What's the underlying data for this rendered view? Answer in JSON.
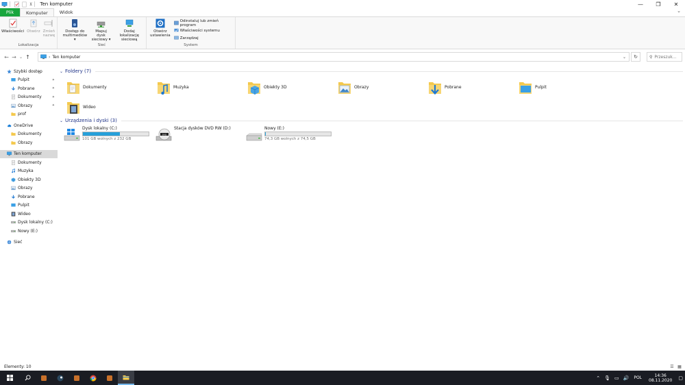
{
  "window": {
    "title": "Ten komputer",
    "controls": {
      "minimize": "—",
      "maximize": "❐",
      "close": "✕"
    }
  },
  "tabs": {
    "file": "Plik",
    "computer": "Komputer",
    "view": "Widok",
    "expand": "⌄"
  },
  "ribbon": {
    "groups": {
      "location": "Lokalizacja",
      "network": "Sieć",
      "system": "System"
    },
    "buttons": {
      "properties": "Właściwości",
      "open": "Otwórz",
      "rename_1": "Zmień",
      "rename_2": "nazwę",
      "media_1": "Dostęp do",
      "media_2": "multimediów ▾",
      "map_1": "Mapuj dysk",
      "map_2": "sieciowy ▾",
      "addloc_1": "Dodaj lokalizację",
      "addloc_2": "sieciową",
      "settings_1": "Otwórz",
      "settings_2": "ustawienia"
    },
    "system_items": {
      "uninstall": "Odinstaluj lub zmień program",
      "sysprops": "Właściwości systemu",
      "manage": "Zarządzaj"
    }
  },
  "nav": {
    "back": "←",
    "forward": "→",
    "recent": "⌄",
    "up": "↑",
    "address": "Ten komputer",
    "address_dropdown": "⌄",
    "refresh": "↻",
    "search_placeholder": "Przeszuk..."
  },
  "sidebar": {
    "items": [
      {
        "label": "Szybki dostęp",
        "icon": "star-icon",
        "indent": 0,
        "pin": false
      },
      {
        "label": "Pulpit",
        "icon": "desktop-folder-icon",
        "indent": 1,
        "pin": true
      },
      {
        "label": "Pobrane",
        "icon": "download-icon",
        "indent": 1,
        "pin": true
      },
      {
        "label": "Dokumenty",
        "icon": "documents-icon",
        "indent": 1,
        "pin": true
      },
      {
        "label": "Obrazy",
        "icon": "pictures-icon",
        "indent": 1,
        "pin": true
      },
      {
        "label": "prof",
        "icon": "folder-icon",
        "indent": 1,
        "pin": false
      },
      {
        "label": "OneDrive",
        "icon": "cloud-icon",
        "indent": 0,
        "pin": false
      },
      {
        "label": "Dokumenty",
        "icon": "folder-icon",
        "indent": 1,
        "pin": false
      },
      {
        "label": "Obrazy",
        "icon": "folder-icon",
        "indent": 1,
        "pin": false
      },
      {
        "label": "Ten komputer",
        "icon": "computer-icon",
        "indent": 0,
        "pin": false,
        "selected": true
      },
      {
        "label": "Dokumenty",
        "icon": "documents-icon",
        "indent": 1,
        "pin": false
      },
      {
        "label": "Muzyka",
        "icon": "music-icon",
        "indent": 1,
        "pin": false
      },
      {
        "label": "Obiekty 3D",
        "icon": "objects3d-icon",
        "indent": 1,
        "pin": false
      },
      {
        "label": "Obrazy",
        "icon": "pictures-icon",
        "indent": 1,
        "pin": false
      },
      {
        "label": "Pobrane",
        "icon": "download-icon",
        "indent": 1,
        "pin": false
      },
      {
        "label": "Pulpit",
        "icon": "desktop-folder-icon",
        "indent": 1,
        "pin": false
      },
      {
        "label": "Wideo",
        "icon": "video-icon",
        "indent": 1,
        "pin": false
      },
      {
        "label": "Dysk lokalny (C:)",
        "icon": "drive-icon",
        "indent": 1,
        "pin": false
      },
      {
        "label": "Nowy (E:)",
        "icon": "drive-icon",
        "indent": 1,
        "pin": false
      },
      {
        "label": "Sieć",
        "icon": "network-icon",
        "indent": 0,
        "pin": false
      }
    ],
    "pin_glyph": "✦"
  },
  "content": {
    "folders_header": "Foldery (7)",
    "folders": [
      {
        "label": "Dokumenty",
        "icon": "documents-folder-icon"
      },
      {
        "label": "Muzyka",
        "icon": "music-folder-icon"
      },
      {
        "label": "Obiekty 3D",
        "icon": "objects3d-folder-icon"
      },
      {
        "label": "Obrazy",
        "icon": "pictures-folder-icon"
      },
      {
        "label": "Pobrane",
        "icon": "downloads-folder-icon"
      },
      {
        "label": "Pulpit",
        "icon": "desktop-folder-icon"
      },
      {
        "label": "Wideo",
        "icon": "video-folder-icon"
      }
    ],
    "drives_header": "Urządzenia i dyski (3)",
    "drives": [
      {
        "label": "Dysk lokalny (C:)",
        "free": "101 GB wolnych z 232 GB",
        "used_fraction": 0.565,
        "icon": "windows-drive-icon"
      },
      {
        "label": "Stacja dysków DVD RW (D:)",
        "free": "",
        "used_fraction": null,
        "icon": "dvd-drive-icon"
      },
      {
        "label": "Nowy (E:)",
        "free": "74,3 GB wolnych z 74,5 GB",
        "used_fraction": 0.003,
        "icon": "drive-icon"
      }
    ],
    "chevron": "⌄"
  },
  "status": {
    "items": "Elementy: 10"
  },
  "taskbar": {
    "apps": [
      "start-icon",
      "search-icon",
      "app-icon",
      "steam-icon",
      "app-icon",
      "chrome-icon",
      "app-icon",
      "file-explorer-icon"
    ],
    "lang": "POL",
    "time": "14:36",
    "date": "08.11.2020"
  },
  "colors": {
    "accent": "#1e3287",
    "file_tab": "#19a63e",
    "drive_fill": "#26a0da",
    "folder_yellow": "#f4c94e",
    "taskbar": "#1a1c23"
  }
}
